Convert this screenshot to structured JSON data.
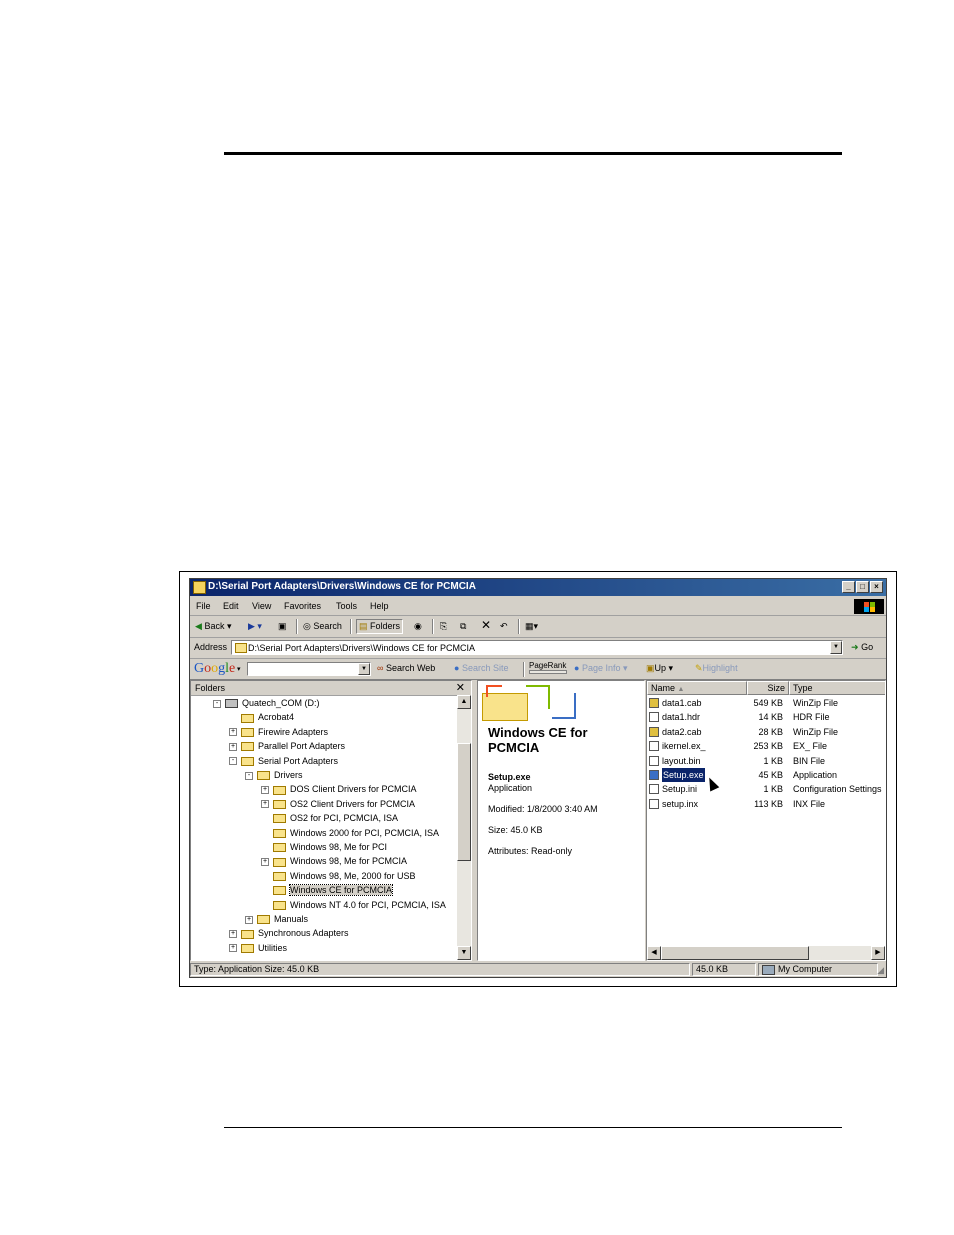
{
  "window": {
    "title": "D:\\Serial Port Adapters\\Drivers\\Windows CE for PCMCIA"
  },
  "menu": [
    "File",
    "Edit",
    "View",
    "Favorites",
    "Tools",
    "Help"
  ],
  "toolbar": {
    "back": "Back",
    "search": "Search",
    "folders": "Folders"
  },
  "address": {
    "label": "Address",
    "value": "D:\\Serial Port Adapters\\Drivers\\Windows CE for PCMCIA",
    "go": "Go"
  },
  "google": {
    "logo": "Google",
    "search_web": "Search Web",
    "search_site": "Search Site",
    "pagerank": "PageRank",
    "page_info": "Page Info",
    "up": "Up",
    "highlight": "Highlight"
  },
  "folders_pane": {
    "header": "Folders",
    "tree": [
      {
        "label": "Quatech_COM (D:)",
        "level": 0,
        "exp": "-"
      },
      {
        "label": "Acrobat4",
        "level": 1,
        "exp": ""
      },
      {
        "label": "Firewire Adapters",
        "level": 1,
        "exp": "+"
      },
      {
        "label": "Parallel Port Adapters",
        "level": 1,
        "exp": "+"
      },
      {
        "label": "Serial Port Adapters",
        "level": 1,
        "exp": "-"
      },
      {
        "label": "Drivers",
        "level": 2,
        "exp": "-"
      },
      {
        "label": "DOS Client Drivers for PCMCIA",
        "level": 3,
        "exp": "+"
      },
      {
        "label": "OS2 Client Drivers for PCMCIA",
        "level": 3,
        "exp": "+"
      },
      {
        "label": "OS2 for PCI, PCMCIA, ISA",
        "level": 3,
        "exp": ""
      },
      {
        "label": "Windows 2000 for PCI, PCMCIA, ISA",
        "level": 3,
        "exp": ""
      },
      {
        "label": "Windows 98, Me for PCI",
        "level": 3,
        "exp": ""
      },
      {
        "label": "Windows 98, Me for PCMCIA",
        "level": 3,
        "exp": "+"
      },
      {
        "label": "Windows 98, Me, 2000 for USB",
        "level": 3,
        "exp": ""
      },
      {
        "label": "Windows CE for PCMCIA",
        "level": 3,
        "exp": "",
        "selected": true
      },
      {
        "label": "Windows NT 4.0 for PCI, PCMCIA, ISA",
        "level": 3,
        "exp": ""
      },
      {
        "label": "Manuals",
        "level": 2,
        "exp": "+"
      },
      {
        "label": "Synchronous Adapters",
        "level": 1,
        "exp": "+"
      },
      {
        "label": "Utilities",
        "level": 1,
        "exp": "+"
      }
    ]
  },
  "info_pane": {
    "folder_title": "Windows CE for PCMCIA",
    "file_name": "Setup.exe",
    "file_type": "Application",
    "modified": "Modified: 1/8/2000 3:40 AM",
    "size": "Size: 45.0 KB",
    "attributes": "Attributes: Read-only"
  },
  "list_pane": {
    "columns": [
      "Name",
      "Size",
      "Type"
    ],
    "files": [
      {
        "name": "data1.cab",
        "size": "549 KB",
        "type": "WinZip File"
      },
      {
        "name": "data1.hdr",
        "size": "14 KB",
        "type": "HDR File"
      },
      {
        "name": "data2.cab",
        "size": "28 KB",
        "type": "WinZip File"
      },
      {
        "name": "ikernel.ex_",
        "size": "253 KB",
        "type": "EX_ File"
      },
      {
        "name": "layout.bin",
        "size": "1 KB",
        "type": "BIN File"
      },
      {
        "name": "Setup.exe",
        "size": "45 KB",
        "type": "Application",
        "selected": true
      },
      {
        "name": "Setup.ini",
        "size": "1 KB",
        "type": "Configuration Settings"
      },
      {
        "name": "setup.inx",
        "size": "113 KB",
        "type": "INX File"
      }
    ]
  },
  "statusbar": {
    "left": "Type: Application Size: 45.0 KB",
    "size": "45.0 KB",
    "zone": "My Computer"
  },
  "colors": {
    "titlebar": "#0a246a",
    "chrome": "#d4d0c8",
    "selection": "#0a246a"
  }
}
